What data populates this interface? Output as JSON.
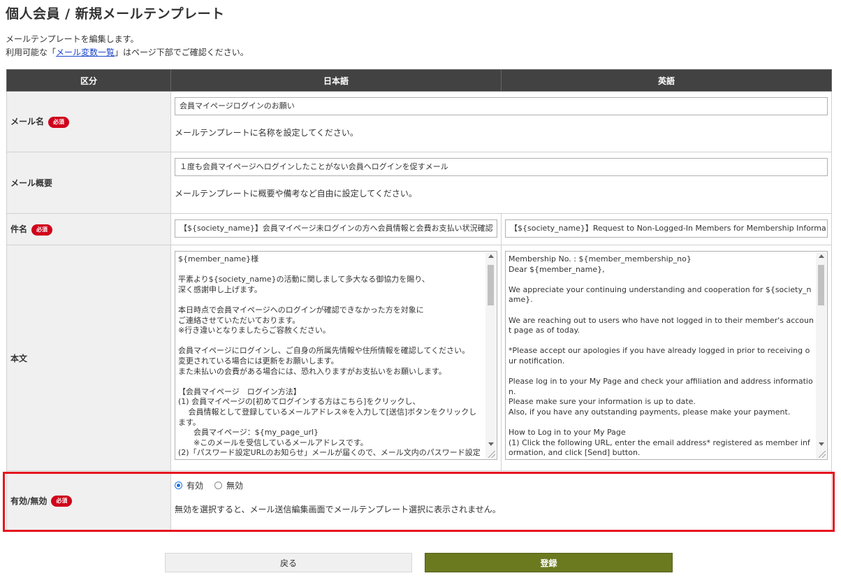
{
  "page": {
    "title": "個人会員 / 新規メールテンプレート",
    "intro_line1": "メールテンプレートを編集します。",
    "intro_line2_prefix": "利用可能な「",
    "intro_link": "メール変数一覧",
    "intro_line2_suffix": "」はページ下部でご確認ください。"
  },
  "table": {
    "headers": [
      "区分",
      "日本語",
      "英語"
    ]
  },
  "required_badge": "必須",
  "mail_name": {
    "label": "メール名",
    "value": "会員マイページログインのお願い",
    "help": "メールテンプレートに名称を設定してください。"
  },
  "mail_summary": {
    "label": "メール概要",
    "value": "１度も会員マイページへログインしたことがない会員へログインを促すメール",
    "help": "メールテンプレートに概要や備考など自由に設定してください。"
  },
  "subject": {
    "label": "件名",
    "value_ja": "【${society_name}】会員マイページ未ログインの方へ会員情報と会費お支払い状況確認",
    "value_en": "【${society_name}】Request to Non-Logged-In Members for Membership Informa"
  },
  "body": {
    "label": "本文",
    "value_ja": "${member_name}様\n\n平素より${society_name}の活動に関しまして多大なる御協力を賜り、\n深く感謝申し上げます。\n\n本日時点で会員マイページへのログインが確認できなかった方を対象に\nご連絡させていただいております。\n※行き違いとなりましたらご容赦ください。\n\n会員マイページにログインし、ご自身の所属先情報や住所情報を確認してください。\n変更されている場合には更新をお願いします。\nまた未払いの会費がある場合には、恐れ入りますがお支払いをお願いします。\n\n【会員マイページ　ログイン方法】\n(1) 会員マイページの[初めてログインする方はこちら]をクリックし、\n　 会員情報として登録しているメールアドレス※を入力して[送信]ボタンをクリックします。\n　　会員マイページ：${my_page_url}\n　　※このメールを受信しているメールアドレスです。\n(2)「パスワード設定URLのお知らせ」メールが届くので、メール文内のパスワード設定URLへ",
    "value_en": "Membership No. : ${member_membership_no}\nDear ${member_name},\n\nWe appreciate your continuing understanding and cooperation for ${society_name}.\n\nWe are reaching out to users who have not logged in to their member's account page as of today.\n\n*Please accept our apologies if you have already logged in prior to receiving our notification.\n\nPlease log in to your My Page and check your affiliation and address information.\nPlease make sure your information is up to date.\nAlso, if you have any outstanding payments, please make your payment.\n\nHow to Log in to your My Page\n(1) Click the following URL, enter the email address* registered as member information, and click [Send] button.\n${my_page_url}"
  },
  "status": {
    "label": "有効/無効",
    "option_enabled": "有効",
    "option_disabled": "無効",
    "selected": "有効",
    "help": "無効を選択すると、メール送信編集画面でメールテンプレート選択に表示されません。"
  },
  "buttons": {
    "back": "戻る",
    "save": "登録"
  },
  "colors": {
    "header_bg": "#424242",
    "required_badge": "#d0021b",
    "save_button": "#6b7a1f",
    "highlight": "#e5141f",
    "link": "#1a44c8"
  }
}
